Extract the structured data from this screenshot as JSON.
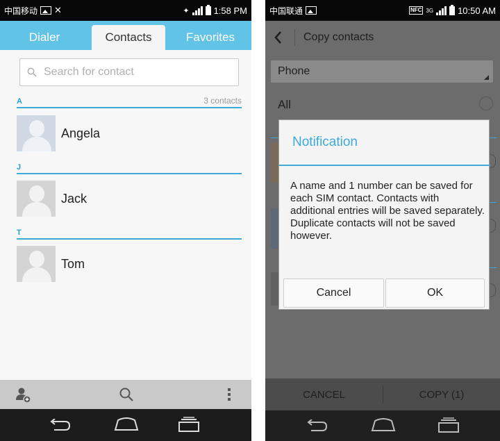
{
  "left": {
    "status": {
      "carrier": "中国移动",
      "time": "1:58 PM"
    },
    "tabs": [
      "Dialer",
      "Contacts",
      "Favorites"
    ],
    "search_placeholder": "Search for contact",
    "sections": [
      {
        "letter": "A",
        "count": "3 contacts",
        "contacts": [
          "Angela"
        ]
      },
      {
        "letter": "J",
        "count": "",
        "contacts": [
          "Jack"
        ]
      },
      {
        "letter": "T",
        "count": "",
        "contacts": [
          "Tom"
        ]
      }
    ],
    "bottom_icons": [
      "add-contact-icon",
      "search-icon",
      "more-icon"
    ],
    "nav_icons": [
      "back-icon",
      "home-icon",
      "recent-apps-icon"
    ]
  },
  "right": {
    "status": {
      "carrier": "中国联通",
      "nfc": "NFC",
      "network": "3G",
      "time": "10:50 AM"
    },
    "header_title": "Copy contacts",
    "dropdown_value": "Phone",
    "all_label": "All",
    "dialog": {
      "title": "Notification",
      "message": "A name and 1 number can be saved for each SIM contact. Contacts with additional entries will be saved separately. Duplicate contacts will not be saved however.",
      "cancel": "Cancel",
      "ok": "OK"
    },
    "actions": {
      "cancel": "CANCEL",
      "copy": "COPY (1)"
    }
  },
  "colors": {
    "accent": "#3ea9d6",
    "tabbar": "#61c3e6"
  }
}
